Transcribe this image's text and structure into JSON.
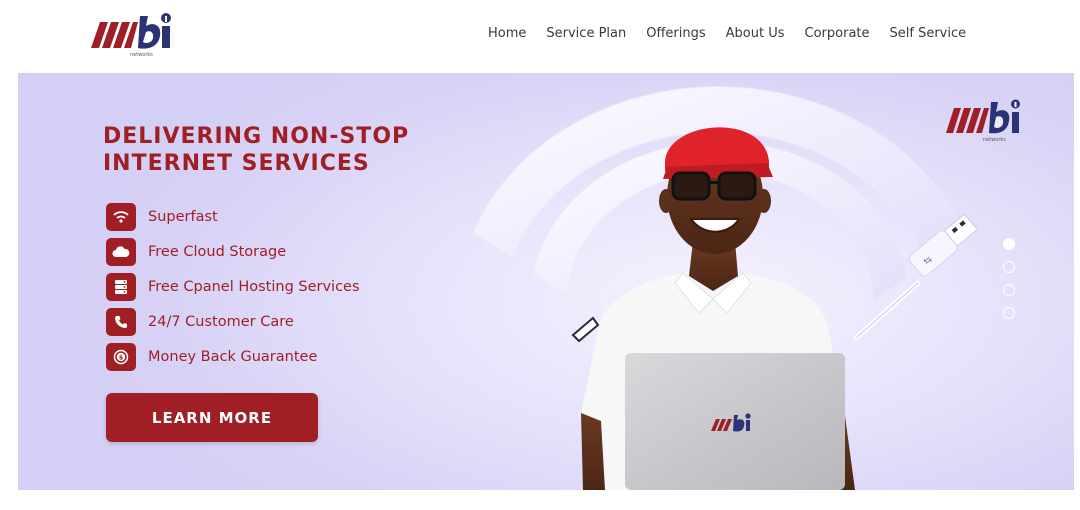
{
  "brand": {
    "logo_text": "mbi",
    "logo_subtext": "networks",
    "colors": {
      "primary_red": "#a01f24",
      "navy": "#2b3275",
      "nav_text": "#333a48"
    }
  },
  "nav": {
    "items": [
      {
        "label": "Home"
      },
      {
        "label": "Service Plan"
      },
      {
        "label": "Offerings"
      },
      {
        "label": "About Us"
      },
      {
        "label": "Corporate"
      },
      {
        "label": "Self Service"
      }
    ]
  },
  "hero": {
    "headline_line1": "DELIVERING NON-STOP",
    "headline_line2": "INTERNET SERVICES",
    "features": [
      {
        "label": "Superfast",
        "icon": "wifi-icon"
      },
      {
        "label": "Free Cloud Storage",
        "icon": "cloud-icon"
      },
      {
        "label": "Free Cpanel Hosting Services",
        "icon": "server-icon"
      },
      {
        "label": "24/7 Customer Care",
        "icon": "phone-icon"
      },
      {
        "label": "Money Back Guarantee",
        "icon": "money-icon"
      }
    ],
    "cta_label": "LEARN MORE",
    "slider": {
      "total": 4,
      "active_index": 0
    }
  }
}
